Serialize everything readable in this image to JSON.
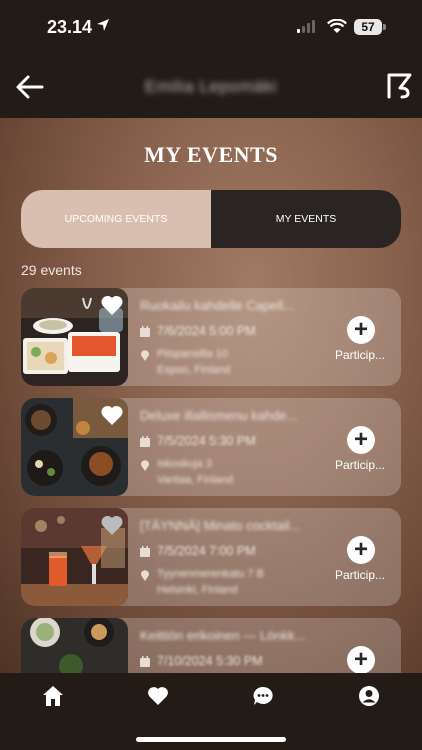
{
  "status_bar": {
    "time": "23.14",
    "battery": "57"
  },
  "header": {
    "title": "Emilia Lepomäki"
  },
  "page": {
    "title": "MY EVENTS",
    "tabs": [
      {
        "label": "UPCOMING EVENTS",
        "selected": false
      },
      {
        "label": "MY EVENTS",
        "selected": true
      }
    ],
    "count_text": "29 events"
  },
  "events": [
    {
      "title": "Ruokailu kahdelle Capell...",
      "date": "7/6/2024 5:00 PM",
      "street": "Piispansilta 10",
      "city": "Espoo, Finland",
      "action_label": "Particip..."
    },
    {
      "title": "Deluxe illallismenu kahde...",
      "date": "7/5/2024 5:30 PM",
      "street": "Iskoskuja 3",
      "city": "Vantaa, Finland",
      "action_label": "Particip..."
    },
    {
      "title": "[TÄYNNÄ] Minato cocktail...",
      "date": "7/5/2024 7:00 PM",
      "street": "Tyynenmerenkatu 7 B",
      "city": "Helsinki, Finland",
      "action_label": "Particip..."
    },
    {
      "title": "Keittiön erikoinen — Lönkk...",
      "date": "7/10/2024 5:30 PM",
      "street": "",
      "city": "",
      "action_label": ""
    }
  ],
  "tabbar": {
    "items": [
      "home-icon",
      "heart-icon",
      "chat-icon",
      "profile-icon"
    ]
  },
  "colors": {
    "accent_dark": "#2a2522",
    "segment_light": "#d8bfb0"
  }
}
